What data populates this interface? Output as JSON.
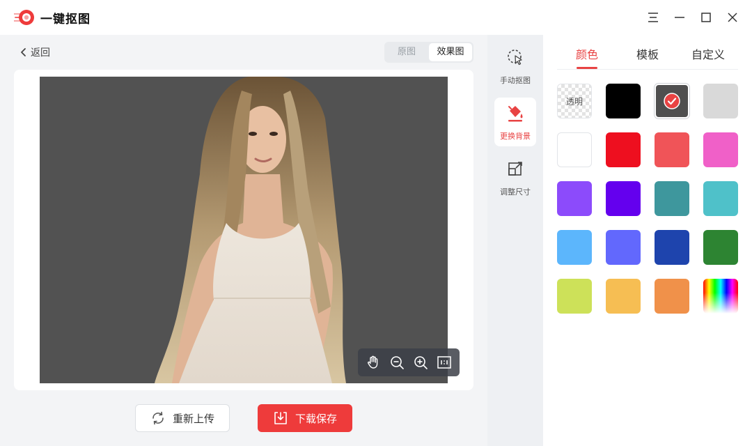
{
  "app": {
    "title": "一键抠图"
  },
  "window_controls": [
    "menu-icon",
    "minimize-icon",
    "maximize-icon",
    "close-icon"
  ],
  "nav": {
    "back_label": "返回"
  },
  "view_toggle": {
    "original_label": "原图",
    "effect_label": "效果图",
    "selected": "效果图"
  },
  "actions": {
    "reupload_label": "重新上传",
    "download_label": "下载保存"
  },
  "zoom_tools": [
    "hand-icon",
    "zoom-out-icon",
    "zoom-in-icon",
    "fit-icon"
  ],
  "tools": [
    {
      "label": "手动抠图",
      "icon": "manual-cutout-icon",
      "active": false
    },
    {
      "label": "更换背景",
      "icon": "paint-bucket-icon",
      "active": true
    },
    {
      "label": "调整尺寸",
      "icon": "resize-icon",
      "active": false
    }
  ],
  "panel": {
    "tabs": [
      {
        "label": "颜色",
        "active": true
      },
      {
        "label": "模板",
        "active": false
      },
      {
        "label": "自定义",
        "active": false
      }
    ],
    "swatches": [
      {
        "name": "transparent",
        "label": "透明"
      },
      {
        "name": "black",
        "color": "#000000"
      },
      {
        "name": "dark-gray",
        "color": "#4f4f4f",
        "selected": true
      },
      {
        "name": "light-gray",
        "color": "#d9d9d9"
      },
      {
        "name": "white",
        "color": "#ffffff"
      },
      {
        "name": "red",
        "color": "#ee0f1f"
      },
      {
        "name": "coral",
        "color": "#f05458"
      },
      {
        "name": "pink",
        "color": "#f060c8"
      },
      {
        "name": "violet",
        "color": "#8c4bfb"
      },
      {
        "name": "indigo",
        "color": "#6400ee"
      },
      {
        "name": "teal",
        "color": "#3e979d"
      },
      {
        "name": "aqua",
        "color": "#4fc1c9"
      },
      {
        "name": "sky-blue",
        "color": "#5cb6fc"
      },
      {
        "name": "periwinkle",
        "color": "#6268fd"
      },
      {
        "name": "navy",
        "color": "#1e44ad"
      },
      {
        "name": "green",
        "color": "#2d8432"
      },
      {
        "name": "lime",
        "color": "#cde159"
      },
      {
        "name": "amber",
        "color": "#f6be53"
      },
      {
        "name": "orange",
        "color": "#f0914a"
      },
      {
        "name": "rainbow",
        "picker": true
      }
    ]
  },
  "accent": "#e84343",
  "preview_background": "#525252"
}
